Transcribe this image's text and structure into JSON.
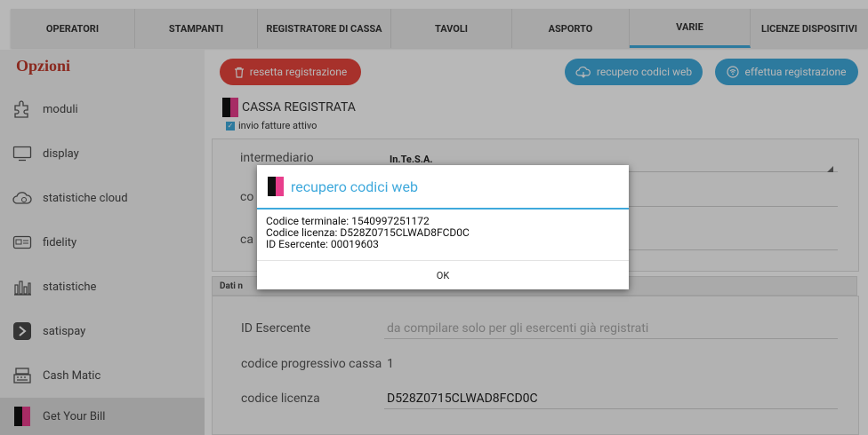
{
  "tabs": [
    "OPERATORI",
    "STAMPANTI",
    "REGISTRATORE DI CASSA",
    "TAVOLI",
    "ASPORTO",
    "VARIE",
    "LICENZE DISPOSITIVI"
  ],
  "sidebar": {
    "title": "Opzioni",
    "items": [
      {
        "label": "moduli",
        "icon": "puzzle-icon"
      },
      {
        "label": "display",
        "icon": "monitor-icon"
      },
      {
        "label": "statistiche cloud",
        "icon": "cloud-icon"
      },
      {
        "label": "fidelity",
        "icon": "card-icon"
      },
      {
        "label": "statistiche",
        "icon": "bar-chart-icon"
      },
      {
        "label": "satispay",
        "icon": "satispay-icon"
      },
      {
        "label": "Cash Matic",
        "icon": "cash-register-icon"
      },
      {
        "label": "Get Your Bill",
        "icon": "getyourbill-logo-icon"
      }
    ]
  },
  "buttons": {
    "reset": "resetta registrazione",
    "recupero": "recupero codici web",
    "registra": "effettua registrazione"
  },
  "cassa": {
    "title": "CASSA REGISTRATA",
    "checkbox_label": "invio fatture attivo"
  },
  "form_top": {
    "intermediario_label": "intermediario",
    "intermediario_value": "In.Te.S.A.",
    "row2_label": "co",
    "row3_label": "ca"
  },
  "section": {
    "header": "Dati n"
  },
  "form_bottom": {
    "id_esercente_label": "ID Esercente",
    "id_esercente_placeholder": "da compilare solo per gli esercenti già registrati",
    "progressivo_label": "codice progressivo cassa",
    "progressivo_value": "1",
    "licenza_label": "codice licenza",
    "licenza_value": "D528Z0715CLWAD8FCD0C"
  },
  "dialog": {
    "title": "recupero codici web",
    "lines": [
      "Codice terminale: 1540997251172",
      "Codice licenza: D528Z0715CLWAD8FCD0C",
      "ID Esercente: 00019603"
    ],
    "ok": "OK"
  },
  "colors": {
    "accent": "#3fa9dc",
    "danger": "#e8453c",
    "brand_pink": "#e83e8c"
  }
}
